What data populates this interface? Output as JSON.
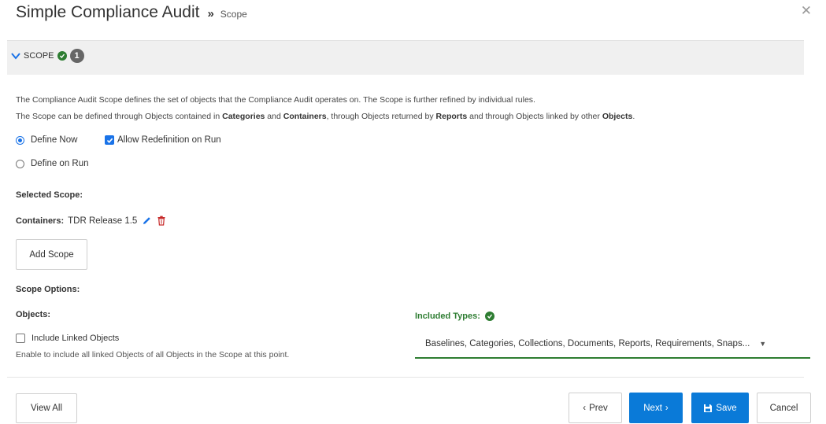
{
  "header": {
    "title": "Simple Compliance Audit",
    "separator": "»",
    "breadcrumb": "Scope",
    "close_icon": "close-icon"
  },
  "section": {
    "label": "SCOPE",
    "count": "1"
  },
  "description": {
    "line1": "The Compliance Audit Scope defines the set of objects that the Compliance Audit operates on. The Scope is further refined by individual rules.",
    "line2": {
      "p1": "The Scope can be defined through Objects contained in ",
      "b1": "Categories",
      "p2": " and ",
      "b2": "Containers",
      "p3": ", through Objects returned by ",
      "b3": "Reports",
      "p4": " and through Objects linked by other ",
      "b4": "Objects",
      "p5": "."
    }
  },
  "definition": {
    "define_now": "Define Now",
    "allow_redefinition": "Allow Redefinition on Run",
    "define_on_run": "Define on Run",
    "define_now_selected": true,
    "allow_redefinition_checked": true
  },
  "selected_scope": {
    "heading": "Selected Scope:",
    "prefix": "Containers:",
    "value": "TDR Release 1.5",
    "add_button": "Add Scope"
  },
  "scope_options": {
    "heading": "Scope Options:",
    "objects_heading": "Objects:",
    "include_linked": "Include Linked Objects",
    "include_linked_checked": false,
    "include_linked_help": "Enable to include all linked Objects of all Objects in the Scope at this point.",
    "included_types_label": "Included Types:",
    "included_types_value": "Baselines, Categories, Collections, Documents, Reports, Requirements, Snaps..."
  },
  "footer": {
    "view_all": "View All",
    "prev": "Prev",
    "next": "Next",
    "save": "Save",
    "cancel": "Cancel"
  },
  "colors": {
    "primary": "#0a7ad8",
    "success": "#2e7d32",
    "danger": "#c62828",
    "section_bg": "#f0f0f0"
  }
}
